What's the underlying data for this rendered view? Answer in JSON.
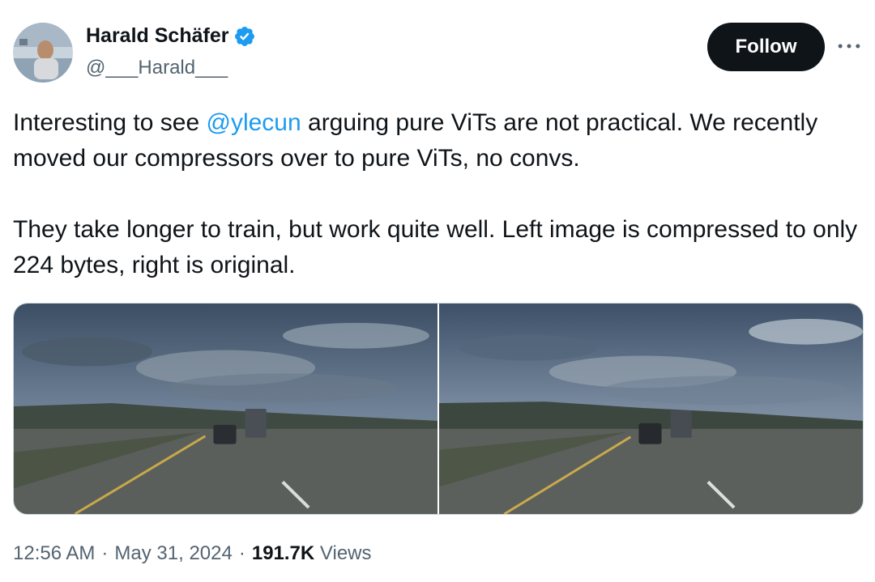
{
  "author": {
    "name": "Harald Schäfer",
    "handle": "@___Harald___",
    "verified_icon": "verified-badge-icon"
  },
  "actions": {
    "follow_label": "Follow",
    "more_icon": "more-icon"
  },
  "tweet": {
    "line1_before": "Interesting to see ",
    "mention": "@ylecun",
    "line1_after": " arguing pure ViTs are not practical. We recently moved our compressors over to pure ViTs, no convs.",
    "paragraph2": "They take longer to train, but work quite well. Left image is compressed to only 224 bytes, right is original."
  },
  "media": {
    "left_image": "compressed-road-image",
    "right_image": "original-road-image"
  },
  "meta": {
    "time": "12:56 AM",
    "separator": "·",
    "date": "May 31, 2024",
    "views_count": "191.7K",
    "views_label": "Views"
  },
  "colors": {
    "accent": "#1d9bf0",
    "text_primary": "#0f1419",
    "text_secondary": "#536471",
    "button_bg": "#0f1419"
  }
}
